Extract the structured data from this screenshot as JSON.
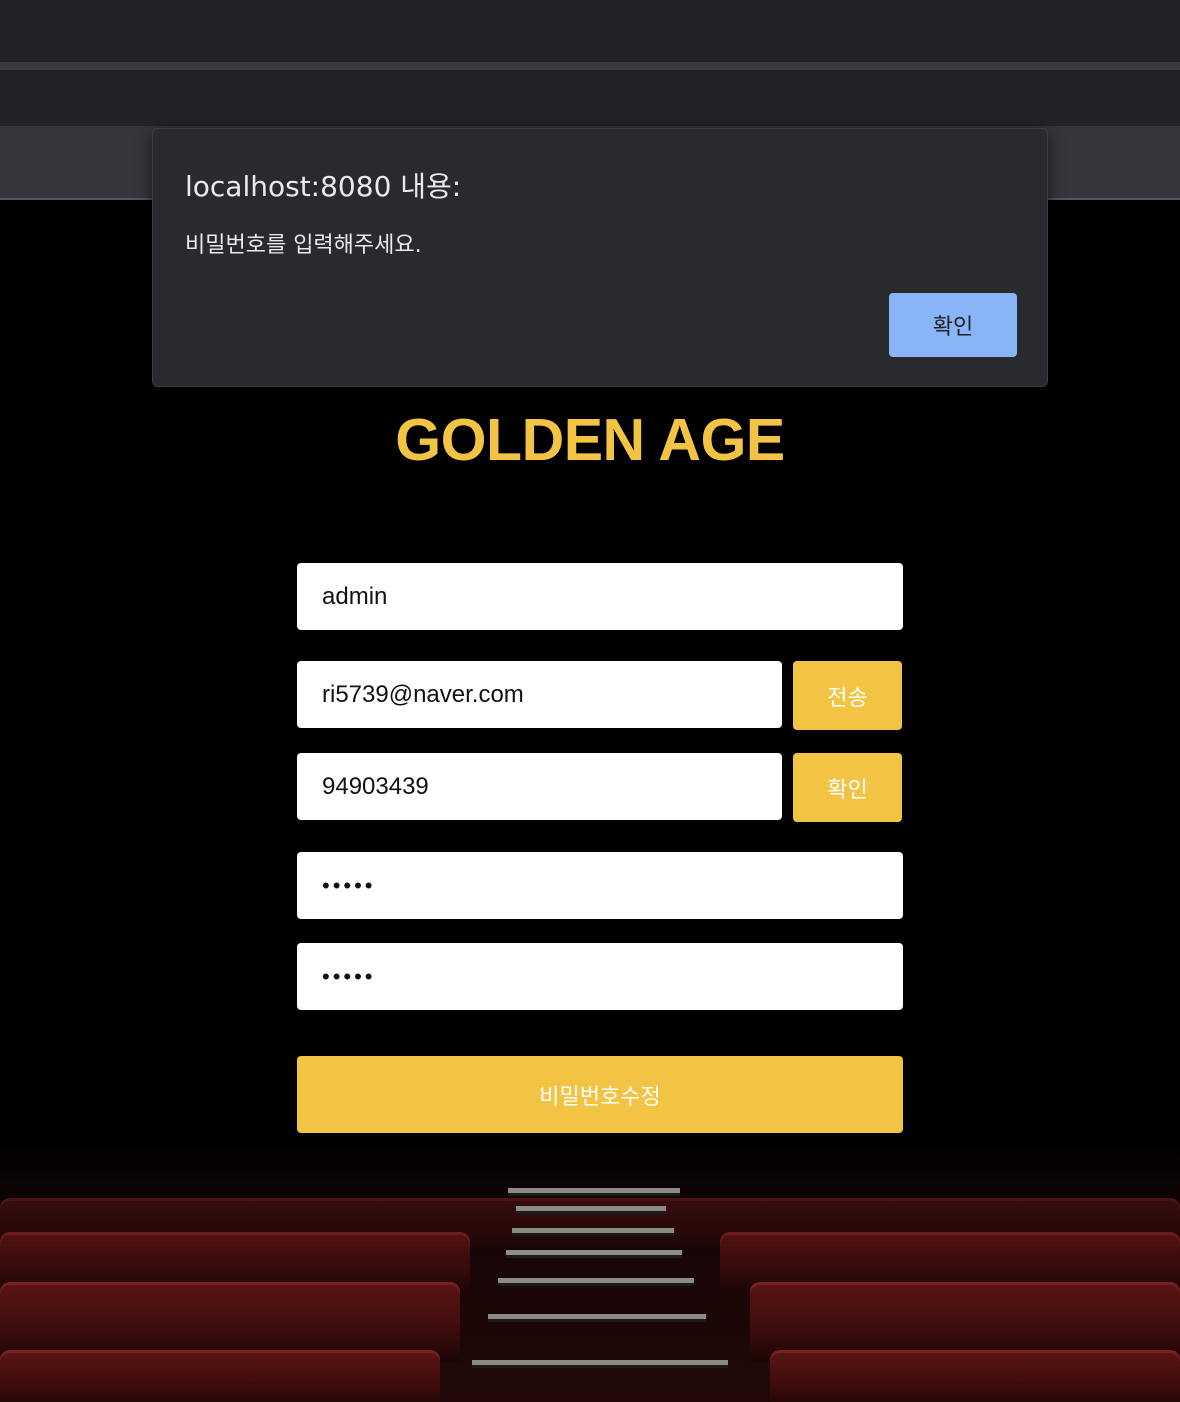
{
  "dialog": {
    "title": "localhost:8080 내용:",
    "message": "비밀번호를 입력해주세요.",
    "ok_label": "확인"
  },
  "page": {
    "brand": "GOLDEN AGE"
  },
  "form": {
    "id_value": "admin",
    "email_value": "ri5739@naver.com",
    "send_label": "전송",
    "code_value": "94903439",
    "confirm_label": "확인",
    "password_mask": "•••••",
    "password_confirm_mask": "•••••",
    "submit_label": "비밀번호수정"
  },
  "colors": {
    "accent": "#f3c343",
    "dialog_bg": "#292a2d",
    "dialog_button": "#8ab4f8"
  }
}
